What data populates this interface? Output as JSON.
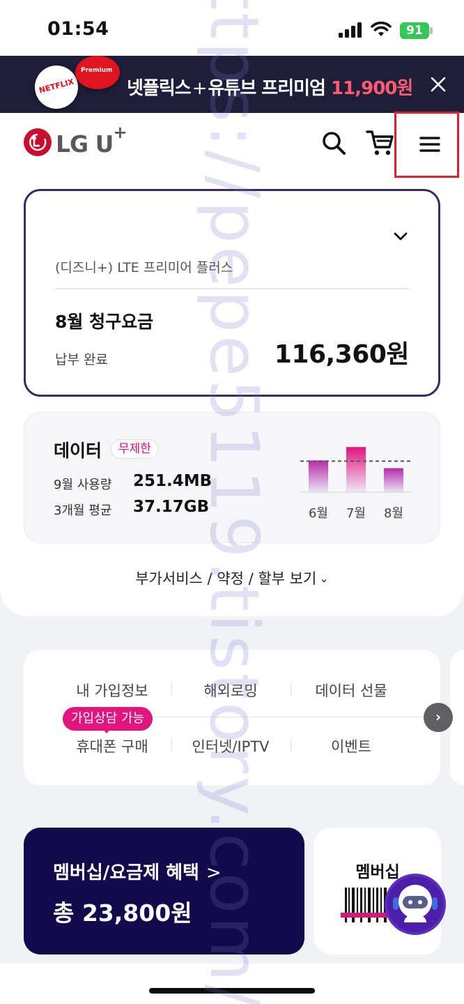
{
  "status_bar": {
    "time": "01:54",
    "battery": "91"
  },
  "banner": {
    "netflix_logo": "NETFLIX",
    "youtube_logo": "Premium",
    "text_main": "넷플릭스",
    "text_plus": "+",
    "text_sub": "유튜브 프리미엄",
    "price": "11,900원",
    "close_icon": "close-icon"
  },
  "header": {
    "brand": "LG U",
    "brand_sup": "+",
    "search_icon": "search-icon",
    "cart_icon": "cart-icon",
    "menu_icon": "hamburger-menu-icon"
  },
  "bill": {
    "plan": "(디즈니+) LTE 프리미어 플러스",
    "title": "8월 청구요금",
    "status": "납부 완료",
    "amount": "116,360원"
  },
  "data_usage": {
    "title": "데이터",
    "badge": "무제한",
    "rows": [
      {
        "label": "9월 사용량",
        "value": "251.4MB"
      },
      {
        "label": "3개월 평균",
        "value": "37.17GB"
      }
    ]
  },
  "chart_data": {
    "type": "bar",
    "categories": [
      "6월",
      "7월",
      "8월"
    ],
    "values": [
      0.95,
      1.35,
      0.72
    ],
    "average_line": 0.93,
    "colors": {
      "bar_top": "#b62aa7",
      "bar_bottom": "#e9e3f8",
      "highlight_top": "#e0157e"
    }
  },
  "more_link": "부가서비스 / 약정 / 할부 보기",
  "quick_menu": {
    "items": [
      "내 가입정보",
      "해외로밍",
      "데이터 선물",
      "휴대폰 구매",
      "인터넷/IPTV",
      "이벤트"
    ],
    "consult_badge": "가입상담 가능",
    "next_icon": "chevron-right-icon"
  },
  "promo": {
    "title": "멤버십/요금제 혜택",
    "arrow": ">",
    "total": "총 23,800원"
  },
  "membership": {
    "title": "멤버십"
  },
  "watermark": "https://pepe5119.tistory.com/"
}
